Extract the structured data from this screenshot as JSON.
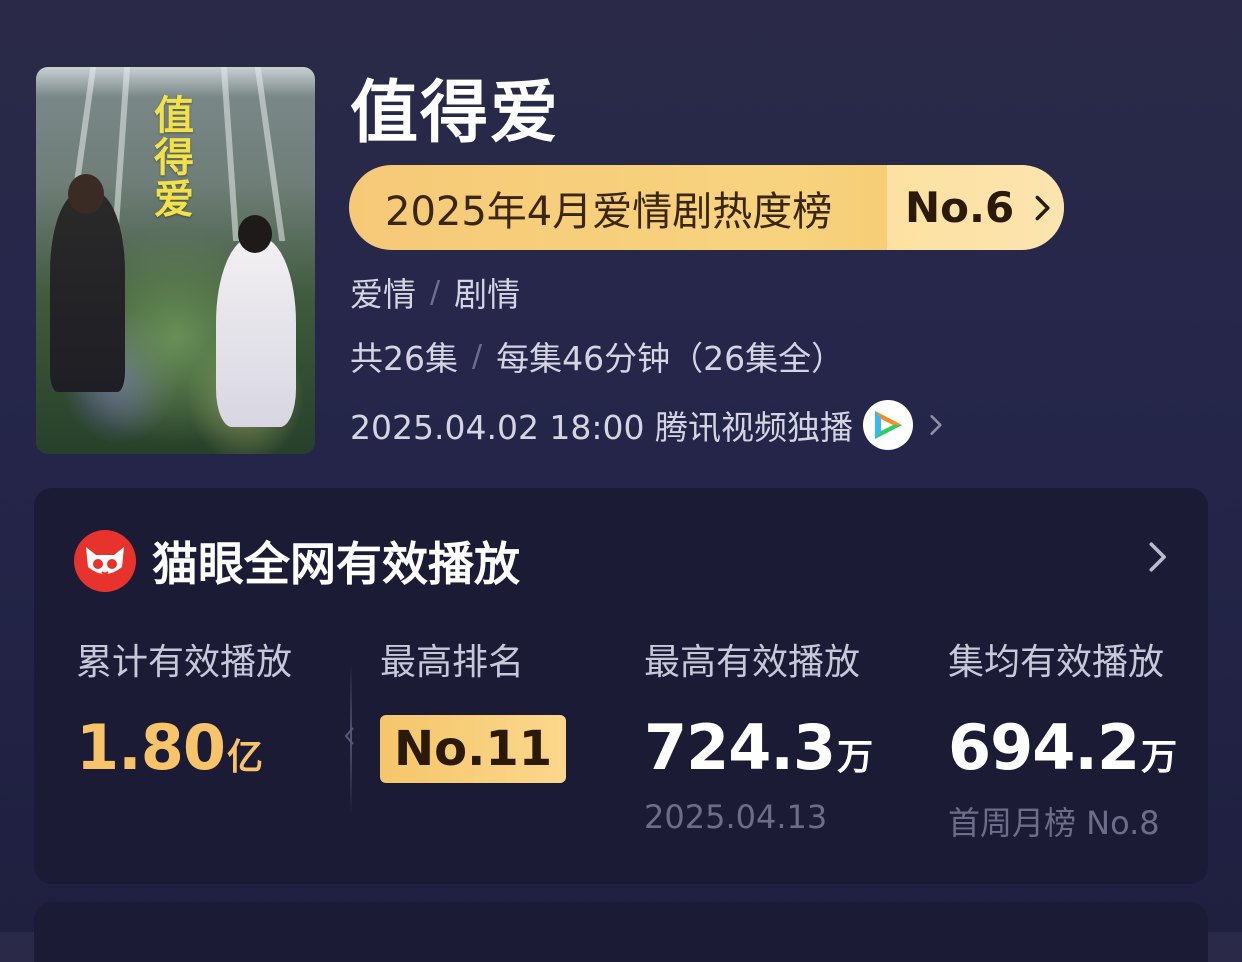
{
  "show": {
    "title": "值得爱",
    "poster_title": "值得爱",
    "rank_pill": {
      "label": "2025年4月爱情剧热度榜",
      "value": "No.6"
    },
    "genres": [
      "爱情",
      "剧情"
    ],
    "episodes": "共26集",
    "episode_info": "每集46分钟（26集全）",
    "release": "2025.04.02 18:00 腾讯视频独播"
  },
  "icons": {
    "platform": "tencent-video-icon",
    "source": "maoyan-cat-icon",
    "chevron": "chevron-right-icon"
  },
  "colors": {
    "background": "#25264a",
    "card": "#1b1b36",
    "accent_gold": "#f8c46a",
    "pill_gold": "#f6c977",
    "maoyan_red": "#e8332c"
  },
  "stats_card": {
    "title": "猫眼全网有效播放",
    "total": {
      "label": "累计有效播放",
      "value": "1.80",
      "unit": "亿"
    },
    "best_rank": {
      "label": "最高排名",
      "value": "No.11"
    },
    "peak": {
      "label": "最高有效播放",
      "value": "724.3",
      "unit": "万",
      "sub": "2025.04.13"
    },
    "average": {
      "label": "集均有效播放",
      "value": "694.2",
      "unit": "万",
      "sub": "首周月榜 No.8"
    }
  }
}
